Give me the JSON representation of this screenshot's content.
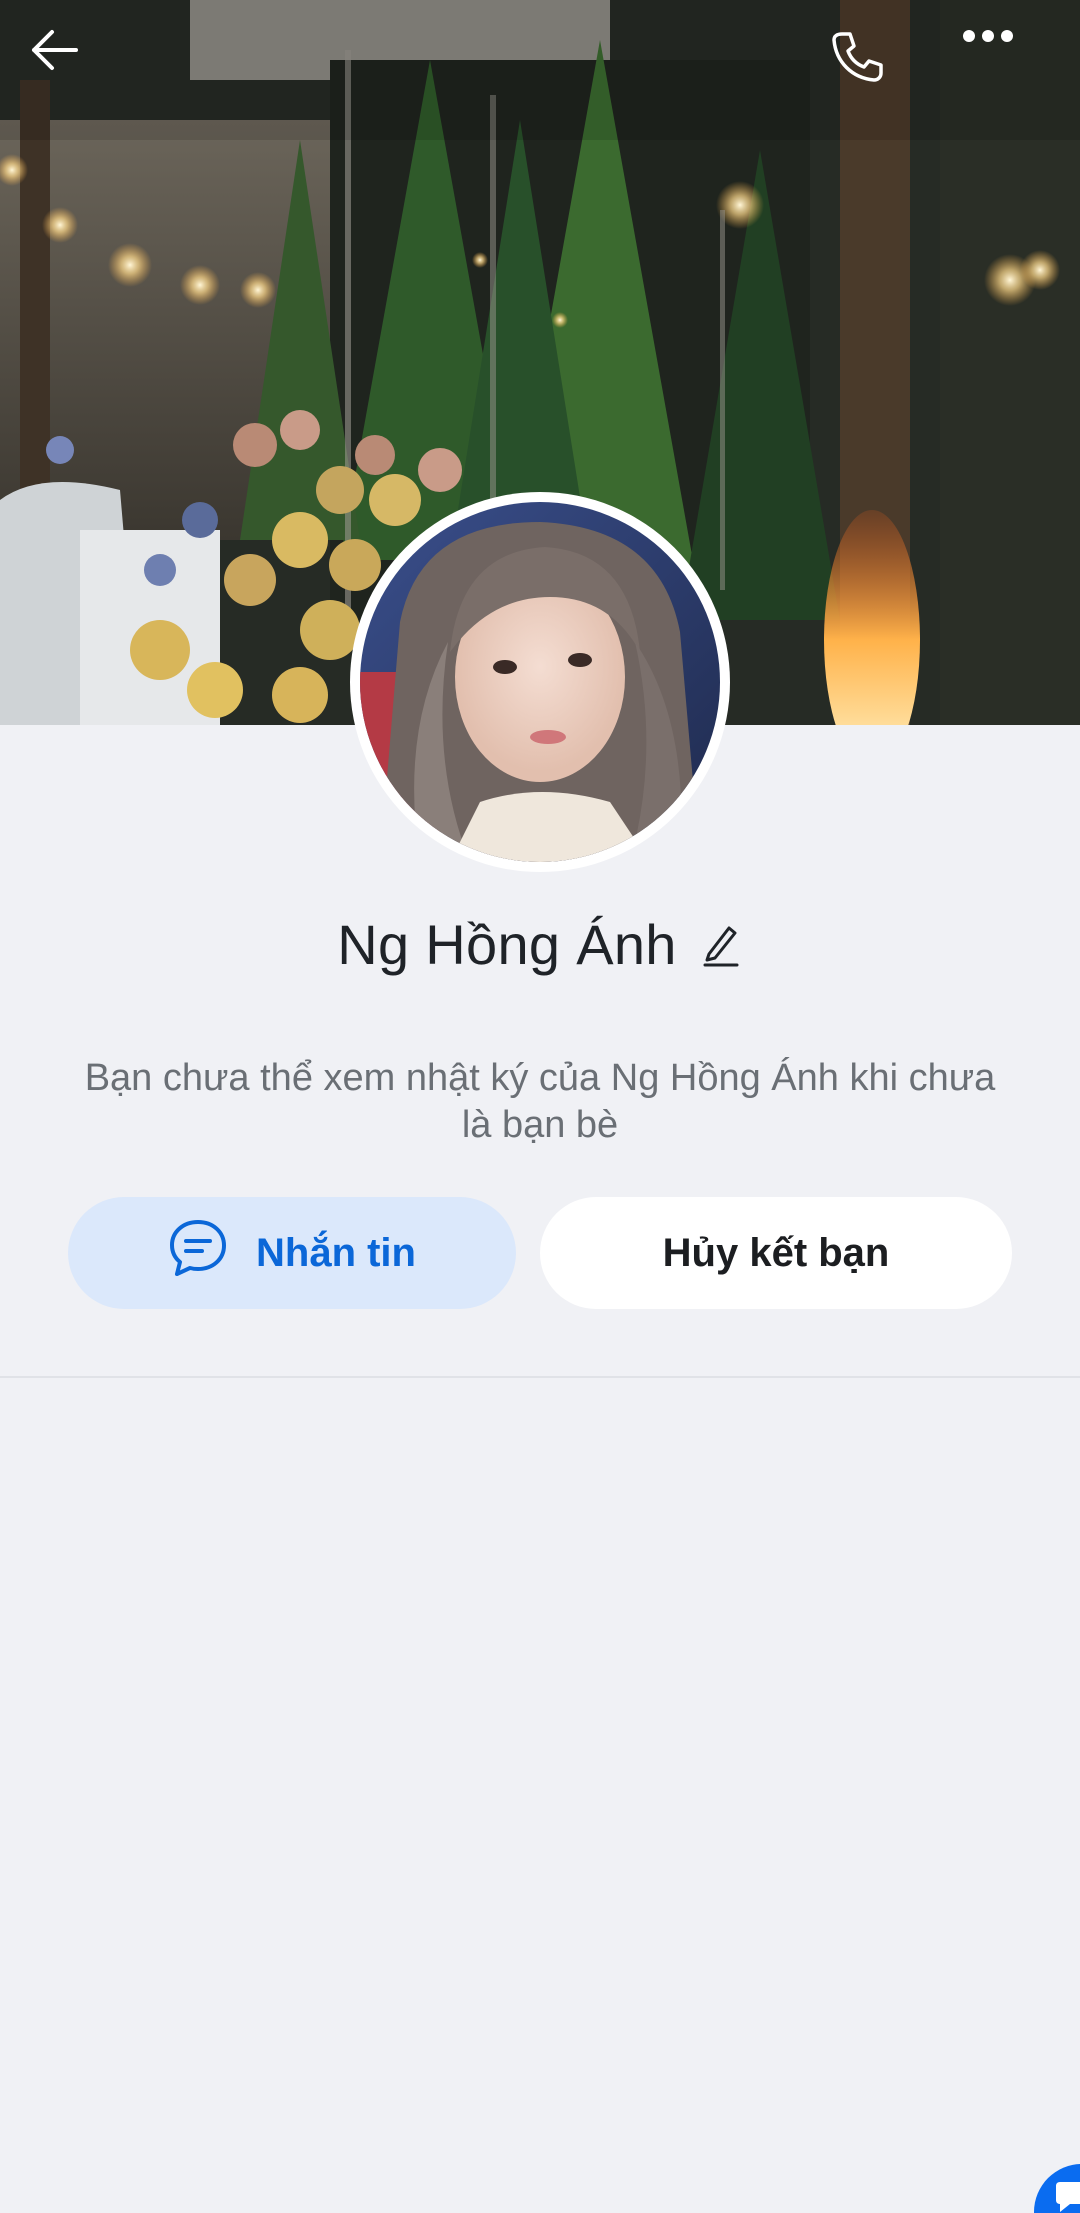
{
  "profile": {
    "name": "Ng Hồng Ánh",
    "notice": "Bạn chưa thể xem nhật ký của Ng Hồng Ánh khi chưa là bạn bè"
  },
  "actions": {
    "message_label": "Nhắn tin",
    "unfriend_label": "Hủy kết bạn"
  },
  "icons": {
    "back": "back-arrow-icon",
    "call": "phone-icon",
    "more": "more-dots-icon",
    "edit": "pencil-icon",
    "message": "chat-bubble-icon",
    "floating": "chat-float-icon"
  },
  "colors": {
    "accent": "#0b67d8",
    "message_bg": "#dbe8fb",
    "background": "#f0f1f5",
    "name_text": "#1f2328",
    "notice_text": "#6a6f75"
  }
}
